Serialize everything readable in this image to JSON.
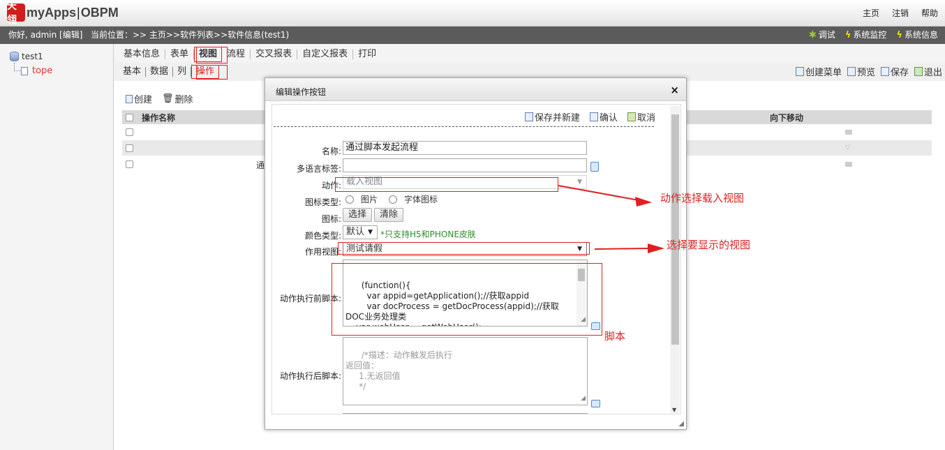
{
  "header": {
    "logo_mark": "天翎",
    "brand": "myApps",
    "product": "OBPM",
    "links": [
      "主页",
      "注销",
      "帮助"
    ]
  },
  "status": {
    "greeting": "你好, admin [编辑]",
    "location": "当前位置：>> 主页>>软件列表>>软件信息(test1)",
    "tools": [
      "调试",
      "系统监控",
      "系统信息"
    ]
  },
  "tree": {
    "root": "test1",
    "child": "tope"
  },
  "tabs_main": [
    "基本信息",
    "表单",
    "视图",
    "流程",
    "交叉报表",
    "自定义报表",
    "打印"
  ],
  "tabs_sub": [
    "基本",
    "数据",
    "列",
    "操作"
  ],
  "right_actions": [
    "创建菜单",
    "预览",
    "保存",
    "退出"
  ],
  "list": {
    "create": "创建",
    "delete": "删除",
    "col_name": "操作名称",
    "col_down": "向下移动",
    "row3_text": "通"
  },
  "modal": {
    "title": "编辑操作按钮",
    "close": "×",
    "actions": [
      "保存并新建",
      "确认",
      "取消"
    ],
    "labels": {
      "name": "名称:",
      "i18n": "多语言标签:",
      "action": "动作:",
      "icon_type": "图标类型:",
      "icon": "图标:",
      "color_type": "颜色类型:",
      "view": "作用视图:",
      "before_script": "动作执行前脚本:",
      "after_script": "动作执行后脚本:"
    },
    "values": {
      "name": "通过脚本发起流程",
      "i18n": "",
      "action": "载入视图",
      "icon_type_options": [
        "图片",
        "字体图标"
      ],
      "icon_buttons": [
        "选择",
        "清除"
      ],
      "color_type": "默认",
      "color_note": "*只支持H5和PHONE皮肤",
      "view": "测试请假",
      "before_script": "(function(){\n        var appid=getApplication();//获取appid\n        var docProcess = getDocProcess(appid);//获取DOC业务处理类\n    var webUser = getWebUser();\n    var formProcess = new",
      "after_script": "/*描述：动作触发后执行\n返回值：\n     1.无返回值\n     */"
    }
  },
  "annotations": {
    "action_note": "动作选择载入视图",
    "view_note": "选择要显示的视图",
    "script_note": "脚本"
  },
  "colors": {
    "annotation_red": "#e02020",
    "statusbar": "#5b5b5b",
    "note_green": "#2e8b2e"
  }
}
